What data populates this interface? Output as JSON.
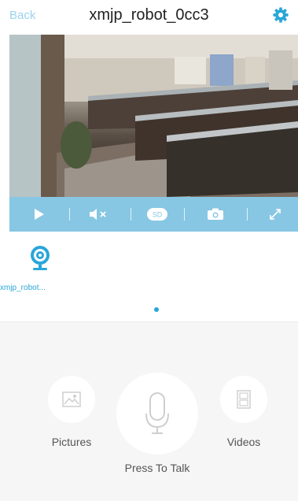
{
  "header": {
    "back_label": "Back",
    "title": "xmjp_robot_0cc3",
    "settings_icon": "gear-icon"
  },
  "video": {
    "toolbar": {
      "icons": [
        "play-icon",
        "mute-icon",
        "sd-quality-icon",
        "snapshot-camera-icon",
        "fullscreen-icon"
      ],
      "quality_label": "SD"
    }
  },
  "device": {
    "name": "xmjp_robot..."
  },
  "actions": {
    "pictures_label": "Pictures",
    "talk_label": "Press To Talk",
    "videos_label": "Videos"
  },
  "colors": {
    "accent": "#2aa6d8",
    "control_bar": "#87c7e3",
    "back_text": "#9ad3ee"
  }
}
